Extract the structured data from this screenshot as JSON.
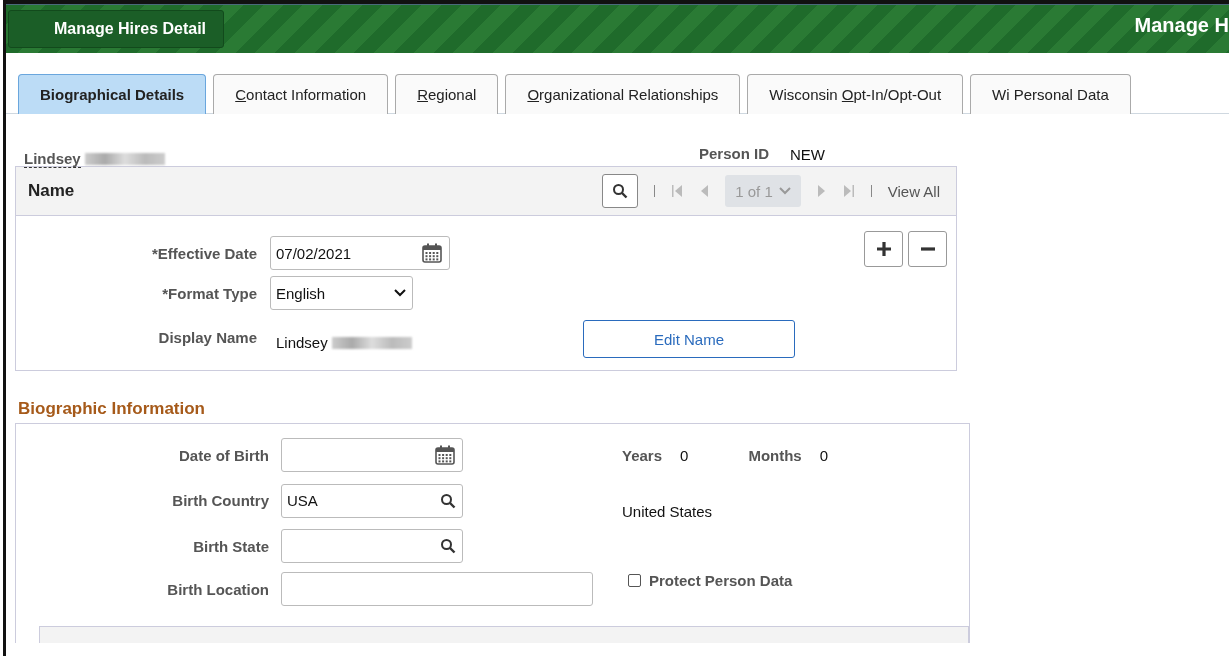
{
  "header": {
    "button": "Manage Hires Detail",
    "title": "Manage H"
  },
  "tabs": [
    {
      "label": "Biographical Details",
      "selected": true
    },
    {
      "key": "C",
      "post": "ontact Information",
      "selected": false
    },
    {
      "key": "R",
      "post": "egional",
      "selected": false
    },
    {
      "key": "O",
      "post": "rganizational Relationships",
      "selected": false
    },
    {
      "pre": "Wisconsin ",
      "key": "O",
      "post": "pt-In/Opt-Out",
      "selected": false
    },
    {
      "label": "Wi Personal Data",
      "selected": false
    }
  ],
  "person": {
    "name": "Lindsey",
    "id_label": "Person ID",
    "id_value": "NEW"
  },
  "name_section": {
    "title": "Name",
    "pager": "1 of 1",
    "view_all": "View All",
    "effective_date_label": "*Effective Date",
    "effective_date": "07/02/2021",
    "format_type_label": "*Format Type",
    "format_type": "English",
    "display_name_label": "Display Name",
    "display_name": "Lindsey",
    "edit_button": "Edit Name"
  },
  "bio": {
    "title": "Biographic Information",
    "dob_label": "Date of Birth",
    "years_label": "Years",
    "years": "0",
    "months_label": "Months",
    "months": "0",
    "country_label": "Birth Country",
    "country": "USA",
    "country_name": "United States",
    "state_label": "Birth State",
    "location_label": "Birth Location",
    "protect": {
      "label": "Protect Person Data",
      "checked": false
    }
  }
}
